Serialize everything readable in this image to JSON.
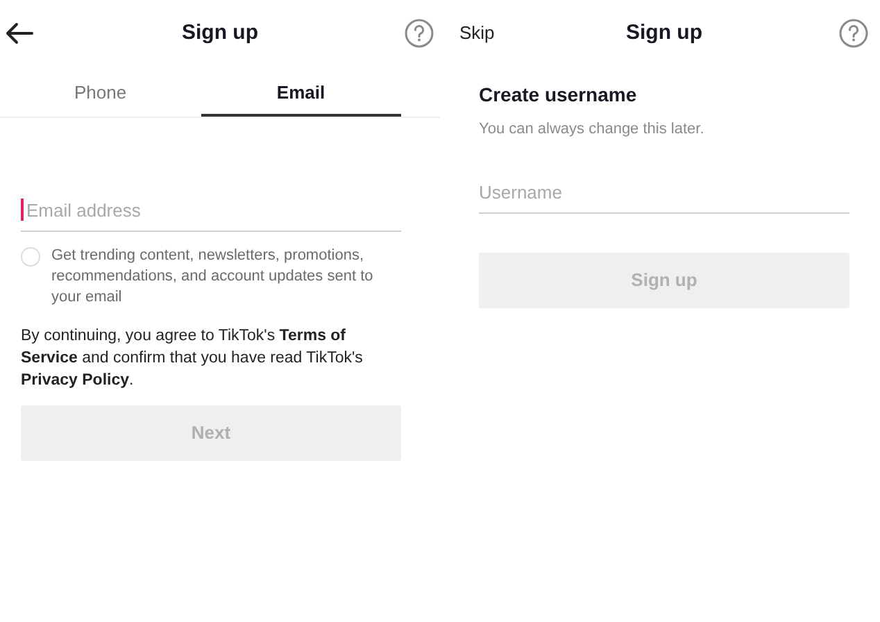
{
  "screens": [
    {
      "header": {
        "back": true,
        "title": "Sign up"
      },
      "tabs": [
        {
          "label": "Phone",
          "selected": false
        },
        {
          "label": "Email",
          "selected": true
        }
      ],
      "field": {
        "placeholder": "Email address",
        "focused": true
      },
      "checkbox": {
        "label": "Get trending content, newsletters, promotions, recommendations, and account updates sent to your email",
        "checked": false
      },
      "terms": "By continuing, you agree to TikTok's  **Terms of Service**  and confirm that you have read TikTok's **Privacy Policy**.",
      "button": {
        "label": "Next",
        "disabled": true
      }
    },
    {
      "header": {
        "back": false,
        "skip": "Skip",
        "title": "Sign up"
      },
      "heading": "Create username",
      "subtitle": "You can always change this later.",
      "field": {
        "placeholder": "Username",
        "focused": false
      },
      "button": {
        "label": "Sign up",
        "disabled": true
      }
    }
  ]
}
